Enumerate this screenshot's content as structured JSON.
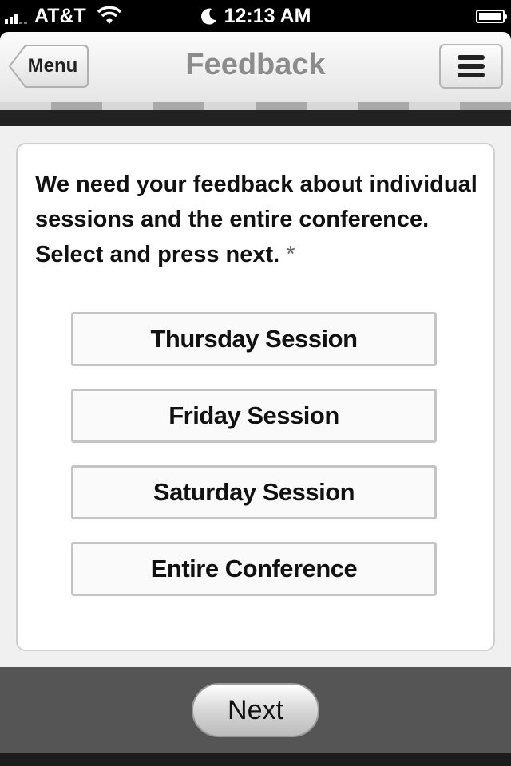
{
  "status_bar": {
    "carrier": "AT&T",
    "time": "12:13 AM",
    "icons": [
      "signal-icon",
      "wifi-icon",
      "moon-icon",
      "battery-icon"
    ]
  },
  "header": {
    "back_label": "Menu",
    "title": "Feedback",
    "menu_icon": "hamburger-icon"
  },
  "form": {
    "question": "We need your feedback about individual sessions and the entire conference. Select and press next.",
    "required_marker": "*",
    "options": [
      "Thursday Session",
      "Friday Session",
      "Saturday Session",
      "Entire Conference"
    ]
  },
  "footer": {
    "next_label": "Next"
  }
}
